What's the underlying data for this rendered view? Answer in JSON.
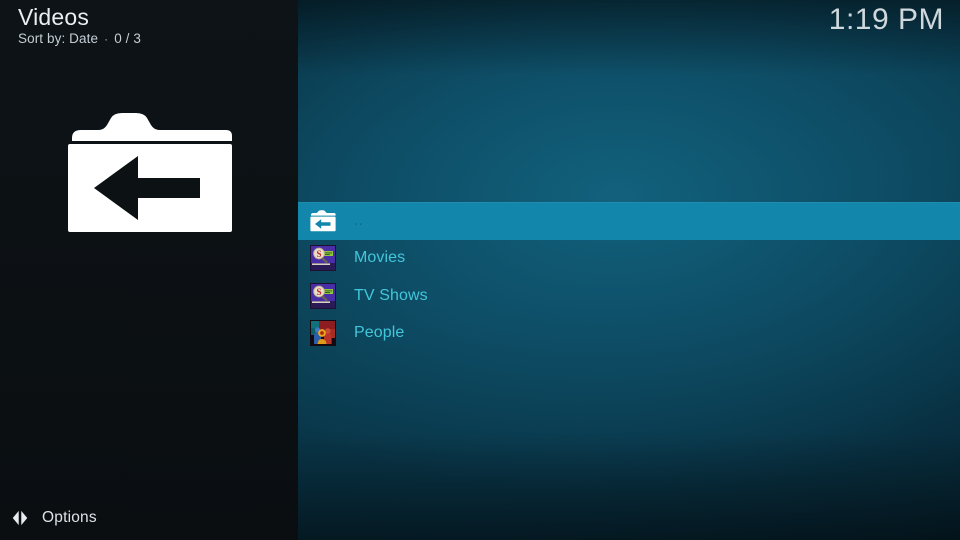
{
  "app": {
    "window_title": "Videos",
    "skin": "Estuary"
  },
  "header": {
    "title": "Videos",
    "sort_label": "Sort by: Date",
    "separator": "·",
    "item_count": "0 / 3"
  },
  "clock": {
    "time": "1:19 PM"
  },
  "preview": {
    "icon_name": "folder-up-icon"
  },
  "list": {
    "items": [
      {
        "label": "..",
        "icon_name": "folder-up-small-icon",
        "selected": true
      },
      {
        "label": "Movies",
        "icon_name": "movies-scraper-thumb-icon",
        "selected": false
      },
      {
        "label": "TV Shows",
        "icon_name": "tvshows-scraper-thumb-icon",
        "selected": false
      },
      {
        "label": "People",
        "icon_name": "people-thumb-icon",
        "selected": false
      }
    ]
  },
  "footer": {
    "options_label": "Options",
    "options_icon_name": "left-right-arrows-icon"
  },
  "colors": {
    "highlight": "#1287ab",
    "list_text": "#42c6da",
    "selected_text": "#0d6c8c",
    "header_text": "#e8eef1",
    "subtext": "#c4ced4",
    "clock_text": "#cfd8dd",
    "left_panel_bg": "#0c1114",
    "content_bg": "#0d4f66"
  }
}
